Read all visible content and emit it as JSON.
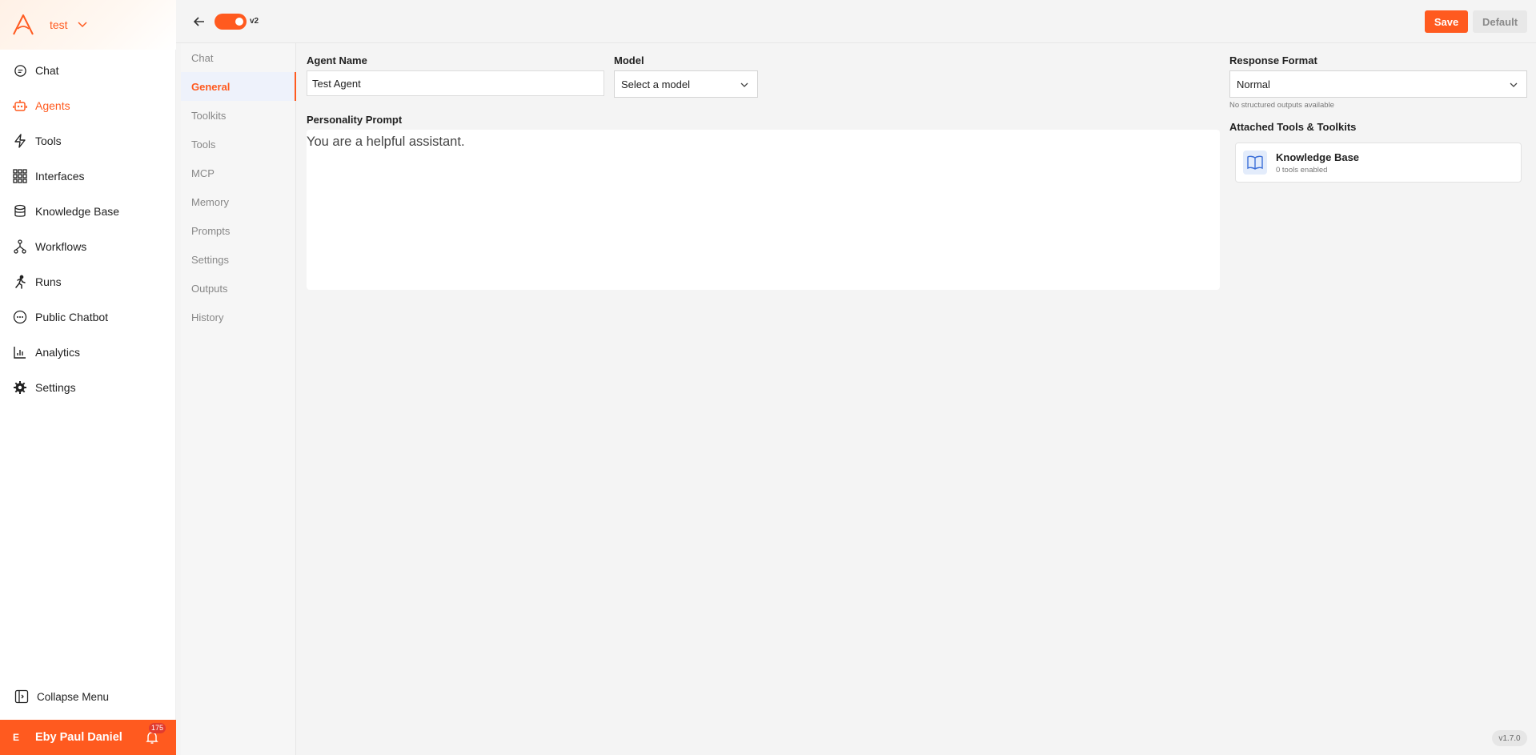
{
  "brand": {
    "name": "test"
  },
  "nav": {
    "items": [
      {
        "label": "Chat",
        "icon": "chat-bubble-icon",
        "active": false
      },
      {
        "label": "Agents",
        "icon": "robot-icon",
        "active": true
      },
      {
        "label": "Tools",
        "icon": "lightning-icon",
        "active": false
      },
      {
        "label": "Interfaces",
        "icon": "grid-icon",
        "active": false
      },
      {
        "label": "Knowledge Base",
        "icon": "database-icon",
        "active": false
      },
      {
        "label": "Workflows",
        "icon": "workflow-icon",
        "active": false
      },
      {
        "label": "Runs",
        "icon": "runner-icon",
        "active": false
      },
      {
        "label": "Public Chatbot",
        "icon": "chat-dots-icon",
        "active": false
      },
      {
        "label": "Analytics",
        "icon": "analytics-icon",
        "active": false
      },
      {
        "label": "Settings",
        "icon": "gear-icon",
        "active": false
      }
    ],
    "collapse_label": "Collapse Menu"
  },
  "user": {
    "initial": "E",
    "name": "Eby Paul Daniel",
    "notifications": "175"
  },
  "topbar": {
    "version_toggle": "v2",
    "save_label": "Save",
    "default_label": "Default"
  },
  "subnav": {
    "items": [
      "Chat",
      "General",
      "Toolkits",
      "Tools",
      "MCP",
      "Memory",
      "Prompts",
      "Settings",
      "Outputs",
      "History"
    ],
    "active_index": 1
  },
  "form": {
    "agent_name_label": "Agent Name",
    "agent_name_value": "Test Agent",
    "model_label": "Model",
    "model_value": "Select a model",
    "response_format_label": "Response Format",
    "response_format_value": "Normal",
    "response_format_hint": "No structured outputs available",
    "personality_label": "Personality Prompt",
    "personality_value": "You are a helpful assistant.",
    "attached_label": "Attached Tools & Toolkits",
    "attached": [
      {
        "title": "Knowledge Base",
        "subtitle": "0 tools enabled",
        "icon": "book-icon"
      }
    ]
  },
  "app_version": "v1.7.0",
  "colors": {
    "accent": "#ff5a1f",
    "sidebar_bg": "#ffffff",
    "page_bg": "#f4f4f4"
  }
}
